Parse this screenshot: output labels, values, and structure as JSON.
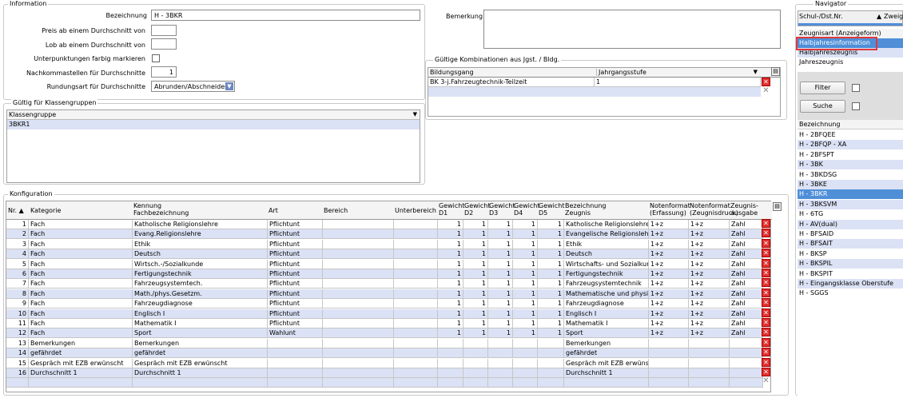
{
  "information": {
    "legend": "Information",
    "bezeichnung_label": "Bezeichnung",
    "bezeichnung_value": "H - 3BKR",
    "preis_label": "Preis ab einem Durchschnitt von",
    "lob_label": "Lob ab einem Durchschnitt von",
    "unterpunktungen_label": "Unterpunktungen farbig markieren",
    "nachkommastellen_label": "Nachkommastellen für Durchschnitte",
    "nachkommastellen_value": "1",
    "rundungsart_label": "Rundungsart für Durchschnitte",
    "rundungsart_value": "Abrunden/Abschneiden",
    "bemerkung_label": "Bemerkung"
  },
  "klassengruppen": {
    "legend": "Gültig für Klassengruppen",
    "header": "Klassengruppe",
    "rows": [
      "3BKR1"
    ]
  },
  "kombinationen": {
    "legend": "Gültige Kombinationen aus Jgst. / Bldg.",
    "headers": [
      "Bildungsgang",
      "Jahrgangsstufe"
    ],
    "rows": [
      {
        "bildungsgang": "BK 3-j.Fahrzeugtechnik-Teilzeit",
        "jahrgangsstufe": "1"
      }
    ]
  },
  "konfiguration": {
    "legend": "Konfiguration",
    "headers": {
      "nr": "Nr.",
      "kategorie": "Kategorie",
      "kennung1": "Kennung",
      "kennung2": "Fachbezeichnung",
      "art": "Art",
      "bereich": "Bereich",
      "unterbereich": "Unterbereich",
      "g1a": "Gewicht",
      "g1b": "D1",
      "g2a": "Gewicht",
      "g2b": "D2",
      "g3a": "Gewicht",
      "g3b": "D3",
      "g4a": "Gewicht",
      "g4b": "D4",
      "g5a": "Gewicht",
      "g5b": "D5",
      "bez1": "Bezeichnung",
      "bez2": "Zeugnis",
      "nf1a": "Notenformat",
      "nf1b": "(Erfassung)",
      "nf2a": "Notenformat",
      "nf2b": "(Zeugnisdruck)",
      "za": "Zeugnis-",
      "zb": "ausgabe"
    },
    "rows": [
      {
        "nr": "1",
        "kategorie": "Fach",
        "kennung": "Katholische Religionslehre",
        "art": "Pflichtunt",
        "g": [
          "1",
          "1",
          "1",
          "1",
          "1"
        ],
        "zeugnis": "Katholische Religionslehre",
        "nf1": "1+z",
        "nf2": "1+z",
        "ausgabe": "Zahl"
      },
      {
        "nr": "2",
        "kategorie": "Fach",
        "kennung": "Evang.Religionslehre",
        "art": "Pflichtunt",
        "g": [
          "1",
          "1",
          "1",
          "1",
          "1"
        ],
        "zeugnis": "Evangelische Religionslehre",
        "nf1": "1+z",
        "nf2": "1+z",
        "ausgabe": "Zahl"
      },
      {
        "nr": "3",
        "kategorie": "Fach",
        "kennung": "Ethik",
        "art": "Pflichtunt",
        "g": [
          "1",
          "1",
          "1",
          "1",
          "1"
        ],
        "zeugnis": "Ethik",
        "nf1": "1+z",
        "nf2": "1+z",
        "ausgabe": "Zahl"
      },
      {
        "nr": "4",
        "kategorie": "Fach",
        "kennung": "Deutsch",
        "art": "Pflichtunt",
        "g": [
          "1",
          "1",
          "1",
          "1",
          "1"
        ],
        "zeugnis": "Deutsch",
        "nf1": "1+z",
        "nf2": "1+z",
        "ausgabe": "Zahl"
      },
      {
        "nr": "5",
        "kategorie": "Fach",
        "kennung": "Wirtsch.-/Sozialkunde",
        "art": "Pflichtunt",
        "g": [
          "1",
          "1",
          "1",
          "1",
          "1"
        ],
        "zeugnis": "Wirtschafts- und Sozialkunde",
        "nf1": "1+z",
        "nf2": "1+z",
        "ausgabe": "Zahl"
      },
      {
        "nr": "6",
        "kategorie": "Fach",
        "kennung": "Fertigungstechnik",
        "art": "Pflichtunt",
        "g": [
          "1",
          "1",
          "1",
          "1",
          "1"
        ],
        "zeugnis": "Fertigungstechnik",
        "nf1": "1+z",
        "nf2": "1+z",
        "ausgabe": "Zahl"
      },
      {
        "nr": "7",
        "kategorie": "Fach",
        "kennung": "Fahrzeugsystemtech.",
        "art": "Pflichtunt",
        "g": [
          "1",
          "1",
          "1",
          "1",
          "1"
        ],
        "zeugnis": "Fahrzeugsystemtechnik",
        "nf1": "1+z",
        "nf2": "1+z",
        "ausgabe": "Zahl"
      },
      {
        "nr": "8",
        "kategorie": "Fach",
        "kennung": "Math./phys.Gesetzm.",
        "art": "Pflichtunt",
        "g": [
          "1",
          "1",
          "1",
          "1",
          "1"
        ],
        "zeugnis": "Mathematische und physikal...",
        "nf1": "1+z",
        "nf2": "1+z",
        "ausgabe": "Zahl"
      },
      {
        "nr": "9",
        "kategorie": "Fach",
        "kennung": "Fahrzeugdiagnose",
        "art": "Pflichtunt",
        "g": [
          "1",
          "1",
          "1",
          "1",
          "1"
        ],
        "zeugnis": "Fahrzeugdiagnose",
        "nf1": "1+z",
        "nf2": "1+z",
        "ausgabe": "Zahl"
      },
      {
        "nr": "10",
        "kategorie": "Fach",
        "kennung": "Englisch I",
        "art": "Pflichtunt",
        "g": [
          "1",
          "1",
          "1",
          "1",
          "1"
        ],
        "zeugnis": "Englisch I",
        "nf1": "1+z",
        "nf2": "1+z",
        "ausgabe": "Zahl"
      },
      {
        "nr": "11",
        "kategorie": "Fach",
        "kennung": "Mathematik I",
        "art": "Pflichtunt",
        "g": [
          "1",
          "1",
          "1",
          "1",
          "1"
        ],
        "zeugnis": "Mathematik I",
        "nf1": "1+z",
        "nf2": "1+z",
        "ausgabe": "Zahl"
      },
      {
        "nr": "12",
        "kategorie": "Fach",
        "kennung": "Sport",
        "art": "Wahlunt",
        "g": [
          "1",
          "1",
          "1",
          "1",
          "1"
        ],
        "zeugnis": "Sport",
        "nf1": "1+z",
        "nf2": "1+z",
        "ausgabe": "Zahl"
      },
      {
        "nr": "13",
        "kategorie": "Bemerkungen",
        "kennung": "Bemerkungen",
        "art": "",
        "g": [
          "",
          "",
          "",
          "",
          ""
        ],
        "zeugnis": "Bemerkungen",
        "nf1": "",
        "nf2": "",
        "ausgabe": ""
      },
      {
        "nr": "14",
        "kategorie": "gefährdet",
        "kennung": "gefährdet",
        "art": "",
        "g": [
          "",
          "",
          "",
          "",
          ""
        ],
        "zeugnis": "gefährdet",
        "nf1": "",
        "nf2": "",
        "ausgabe": ""
      },
      {
        "nr": "15",
        "kategorie": "Gespräch mit EZB erwünscht",
        "kennung": "Gespräch mit EZB erwünscht",
        "art": "",
        "g": [
          "",
          "",
          "",
          "",
          ""
        ],
        "zeugnis": "Gespräch mit EZB erwünscht",
        "nf1": "",
        "nf2": "",
        "ausgabe": ""
      },
      {
        "nr": "16",
        "kategorie": "Durchschnitt 1",
        "kennung": "Durchschnitt 1",
        "art": "",
        "g": [
          "",
          "",
          "",
          "",
          ""
        ],
        "zeugnis": "Durchschnitt 1",
        "nf1": "",
        "nf2": "",
        "ausgabe": ""
      }
    ]
  },
  "navigator": {
    "legend": "Navigator",
    "col1": "Schul-/Dst.Nr.",
    "col2": "Zweig",
    "zeugnisart_header": "Zeugnisart (Anzeigeform)",
    "zeugnisarten": [
      "Halbjahresinformation",
      "Halbjahreszeugnis",
      "Jahreszeugnis"
    ],
    "filter_label": "Filter",
    "suche_label": "Suche",
    "bez_header": "Bezeichnung",
    "items": [
      "H - 2BFQEE",
      "H - 2BFQP - XA",
      "H - 2BFSPT",
      "H - 3BK",
      "H - 3BKDSG",
      "H - 3BKE",
      "H - 3BKR",
      "H - 3BKSVM",
      "H - 6TG",
      "H - AV(dual)",
      "H - BFSAID",
      "H - BFSAIT",
      "H - BKSP",
      "H - BKSPIL",
      "H - BKSPIT",
      "H - Eingangsklasse Oberstufe",
      "H - SGGS"
    ],
    "selected_index": 6
  },
  "colors": {
    "row_alt": "#dbe2f5",
    "selected": "#4f8fd8",
    "highlight_border": "#e03a3a"
  }
}
